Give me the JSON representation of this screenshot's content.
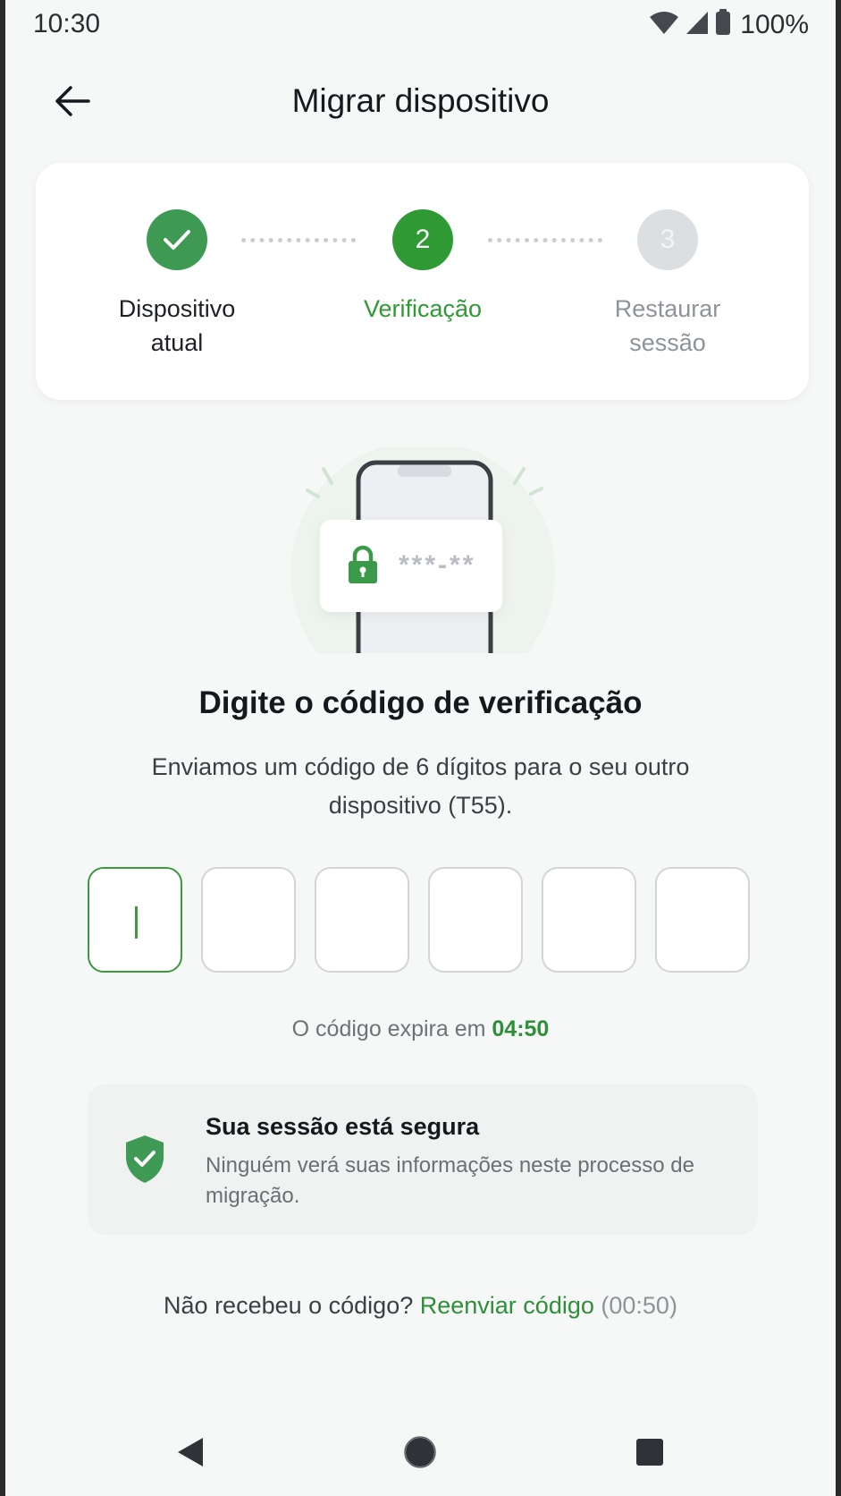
{
  "status_bar": {
    "time": "10:30",
    "battery": "100%"
  },
  "app_bar": {
    "title": "Migrar dispositivo"
  },
  "stepper": {
    "steps": [
      {
        "number": "1",
        "label_line1": "Dispositivo",
        "label_line2": "atual",
        "state": "completed"
      },
      {
        "number": "2",
        "label_line1": "Verificação",
        "label_line2": "",
        "state": "active"
      },
      {
        "number": "3",
        "label_line1": "Restaurar",
        "label_line2": "sessão",
        "state": "pending"
      }
    ]
  },
  "illustration": {
    "masked_code": "***-**"
  },
  "verification": {
    "heading": "Digite o código de verificação",
    "description": "Enviamos um código de 6 dígitos para o seu outro dispositivo (T55).",
    "digits": [
      "",
      "",
      "",
      "",
      "",
      ""
    ],
    "expiry_prefix": "O código expira em",
    "expiry_time": "04:50"
  },
  "security": {
    "title": "Sua sessão está segura",
    "body": "Ninguém verá suas informações neste processo de migração."
  },
  "resend": {
    "prompt": "Não recebeu o código?",
    "link": "Reenviar código",
    "timer": "(00:50)"
  },
  "colors": {
    "primary_green": "#2f9a33",
    "completed_green": "#3e9a52",
    "pending_gray": "#dcdfe2"
  }
}
